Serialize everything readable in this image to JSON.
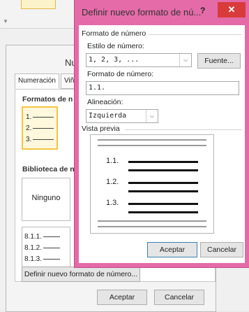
{
  "back_dialog": {
    "title": "Nu",
    "tabs": [
      "Numeración",
      "Viñet"
    ],
    "group_formats": "Formatos de n",
    "format_sample": [
      "1.",
      "2.",
      "3."
    ],
    "group_library": "Biblioteca de n",
    "none_label": "Ninguno",
    "multilevel_sample": [
      "8.1.1.",
      "8.1.2.",
      "8.1.3."
    ],
    "define_button": "Definir nuevo formato de número...",
    "ok_button": "Aceptar",
    "cancel_button": "Cancelar"
  },
  "front_dialog": {
    "title": "Definir nuevo formato de nú...",
    "help_glyph": "?",
    "close_glyph": "✕",
    "section_format": "Formato de número",
    "style_label": "Estilo de número:",
    "style_value": "1, 2, 3, ...",
    "font_button": "Fuente...",
    "format_label": "Formato de número:",
    "format_value": "1.1.",
    "alignment_label": "Alineación:",
    "alignment_value": "Izquierda",
    "preview_label": "Vista previa",
    "preview_items": [
      "1.1.",
      "1.2.",
      "1.3."
    ],
    "ok_button": "Aceptar",
    "cancel_button": "Cancelar"
  },
  "colors": {
    "accent_border": "#e46ba8",
    "close_red": "#d93b3b",
    "selected_tile": "#f4c542"
  }
}
